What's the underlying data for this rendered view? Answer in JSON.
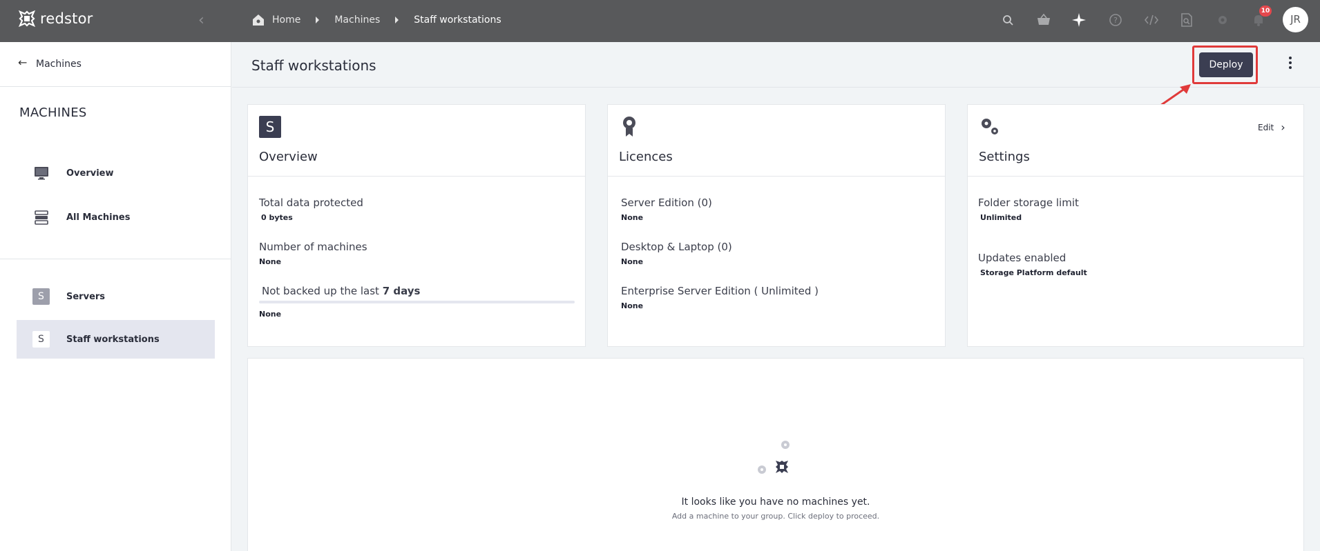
{
  "app": {
    "brand": "redstor"
  },
  "breadcrumb": [
    "Home",
    "Machines",
    "Staff workstations"
  ],
  "topbar": {
    "notification_count": "10",
    "user_initials": "JR"
  },
  "sidebar": {
    "back_label": "Machines",
    "section_title": "MACHINES",
    "items": [
      {
        "label": "Overview",
        "icon": "monitor-icon"
      },
      {
        "label": "All Machines",
        "icon": "server-stack-icon"
      }
    ],
    "groups": [
      {
        "chip": "S",
        "label": "Servers",
        "active": false
      },
      {
        "chip": "S",
        "label": "Staff workstations",
        "active": true
      }
    ]
  },
  "header": {
    "title": "Staff workstations",
    "deploy_label": "Deploy"
  },
  "overview": {
    "icon_letter": "S",
    "title": "Overview",
    "fields": [
      {
        "label": "Total data protected",
        "value": "0 bytes"
      },
      {
        "label": "Number of machines",
        "value": "None"
      }
    ],
    "backup_label_prefix": "Not backed up the last",
    "backup_label_bold": "7 days",
    "backup_value": "None"
  },
  "licences": {
    "title": "Licences",
    "fields": [
      {
        "label": "Server Edition (0)",
        "value": "None"
      },
      {
        "label": "Desktop & Laptop (0)",
        "value": "None"
      },
      {
        "label": "Enterprise Server Edition ( Unlimited )",
        "value": "None"
      }
    ]
  },
  "settings": {
    "title": "Settings",
    "edit_label": "Edit",
    "fields": [
      {
        "label": "Folder storage limit",
        "value": "Unlimited"
      },
      {
        "label": "Updates enabled",
        "value": "Storage Platform default"
      }
    ]
  },
  "empty_state": {
    "title": "It looks like you have no machines yet.",
    "subtitle": "Add a machine to your group. Click deploy to proceed."
  },
  "colors": {
    "topbar": "#58595b",
    "accent": "#3b3e52",
    "highlight": "#e03a3a",
    "badge": "#e5484d"
  }
}
